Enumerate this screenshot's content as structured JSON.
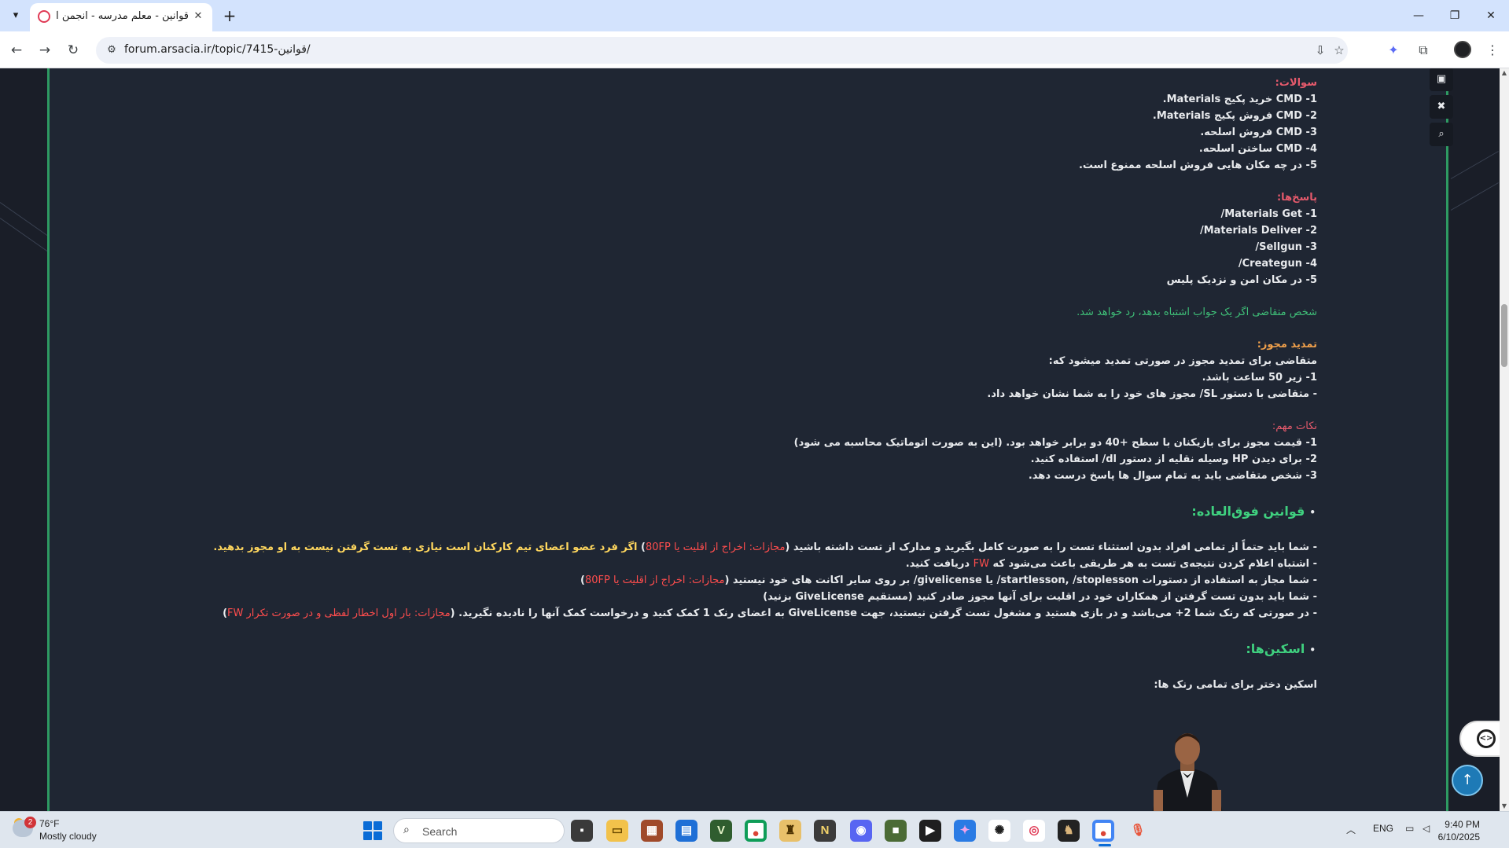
{
  "browser": {
    "tab_title": "قوانین - معلم مدرسه - انجمن آرس...",
    "url": "forum.arsacia.ir/topic/7415-قوانین/"
  },
  "post": {
    "questions_title": "سوالات:",
    "questions": [
      "1- CMD خرید پکیج Materials.",
      "2- CMD فروش پکیج Materials.",
      "3- CMD فروش اسلحه.",
      "4- CMD ساختن اسلحه.",
      "5- در چه مکان هایی فروش اسلحه ممنوع است."
    ],
    "answers_title": "پاسخ‌ها:",
    "answers": [
      "1- Materials Get/",
      "2- Materials Deliver/",
      "3- Sellgun/",
      "4- Creategun/",
      "5- در مکان امن و نزدیک پلیس"
    ],
    "fail_note": "شخص متقاضی اگر یک جواب اشتباه بدهد، رد خواهد شد.",
    "renewal_title": "تمدید مجوز:",
    "renewal_lines": [
      "متقاضی برای تمدید مجوز در صورتی تمدید میشود که:",
      "1- زیر 50 ساعت باشد.",
      "- متقاضی با دستور SL/ مجوز های خود را به شما نشان خواهد داد."
    ],
    "notes_title": "نکات مهم:",
    "notes": [
      "1- قیمت مجوز برای بازیکنان با سطح +40 دو برابر خواهد بود. (این به صورت اتوماتیک محاسبه می شود)",
      "2- برای دیدن HP وسیله نقلیه از دستور dl/ استفاده کنید.",
      "3- شخص متقاضی باید به تمام سوال ها پاسخ درست دهد."
    ],
    "special_rules_title": "قوانین فوق‌العاده:",
    "special_rules": {
      "r1_a": "- شما باید حتماً از تمامی افراد بدون استثناء تست را به صورت کامل بگیرید و مدارک از تست داشته باشید (",
      "r1_penalty": "مجازات: اخراج از اقلیت یا 80FP",
      "r1_b": ") ",
      "r1_highlight": "اگر فرد عضو اعضای تیم کارکنان است نیازی به تست گرفتن نیست به او مجوز بدهید.",
      "r2_a": "- اشتباه اعلام کردن نتیجه‌ی تست به هر طریقی باعث می‌شود که ",
      "r2_penalty": "FW",
      "r2_b": " دریافت کنید.",
      "r3_a": "- شما مجاز به استفاده از دستورات startlesson, /stoplesson/ یا givelicense/ بر روی سایر اکانت های خود نیستید (",
      "r3_penalty": "مجازات: اخراج از اقلیت یا 80FP",
      "r3_b": ")",
      "r4": "- شما باید بدون تست گرفتن از همکاران خود در اقلیت برای آنها مجوز صادر کنید (مستقیم GiveLicense بزنید)",
      "r5_a": "- در صورتی که رنک شما 2+ می‌باشد و در بازی هستید و مشغول تست گرفتن نیستید، جهت GiveLicense به اعضای رنک 1 کمک کنید و درخواست کمک آنها را نادیده نگیرید. (",
      "r5_penalty": "مجازات: بار اول اخطار لفظی و در صورت تکرار FW",
      "r5_b": ")"
    },
    "skins_title": "اسکین‌ها:",
    "skins_line": "اسکین دختر برای تمامی رنک ها:"
  },
  "taskbar": {
    "weather_badge": "2",
    "weather_temp": "76°F",
    "weather_desc": "Mostly cloudy",
    "search_placeholder": "Search",
    "lang": "ENG",
    "time": "9:40 PM",
    "date": "6/10/2025"
  },
  "colors": {
    "panel_bg": "#1f2633",
    "border_green": "#2e9a62",
    "heading_red": "#e65a6c",
    "heading_orange": "#f0a04b",
    "text_green": "#3fbf78",
    "penalty_red": "#ff4d4d",
    "highlight_yellow": "#ffd75e"
  }
}
